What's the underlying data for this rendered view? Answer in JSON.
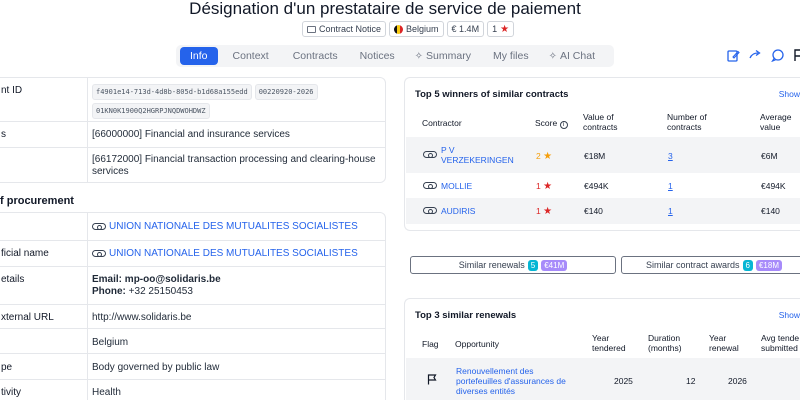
{
  "page": {
    "title": "Désignation d'un prestataire de service de paiement",
    "badges": {
      "notice": "Contract Notice",
      "country": "Belgium",
      "value": "€ 1.4M",
      "score": "1"
    }
  },
  "tabs": [
    {
      "label": "Info"
    },
    {
      "label": "Context"
    },
    {
      "label": "Contracts"
    },
    {
      "label": "Notices"
    },
    {
      "label": "Summary"
    },
    {
      "label": "My files"
    },
    {
      "label": "AI Chat"
    }
  ],
  "details": {
    "notice_id_label": "nt ID",
    "notice_id_values": [
      "f4901e14-713d-4d8b-805d-b1d68a155edd",
      "00220920-2026",
      "01KN0K1900Q2HGRPJNQDWOHDWZ"
    ],
    "cpv_label": "s",
    "cpv_main": "[66000000] Financial and insurance services",
    "cpv_secondary": "[66172000] Financial transaction processing and clearing-house services",
    "procurement_heading": "f procurement",
    "buyer_label": "",
    "buyer": "UNION NATIONALE DES MUTUALITES SOCIALISTES",
    "official_label": "ficial name",
    "official": "UNION NATIONALE DES MUTUALITES SOCIALISTES",
    "contact_label": "etails",
    "email_label": "Email:",
    "email": "mp-oo@solidaris.be",
    "phone_label": "Phone:",
    "phone": "+32 25150453",
    "url_label": "xternal URL",
    "url": "http://www.solidaris.be",
    "country_label": "",
    "country": "Belgium",
    "type_label": "pe",
    "type": "Body governed by public law",
    "activity_label": "tivity",
    "activity": "Health"
  },
  "winners": {
    "title": "Top 5 winners of similar contracts",
    "show": "Show",
    "headers": {
      "contractor": "Contractor",
      "score": "Score",
      "value": "Value of contracts",
      "number": "Number of contracts",
      "average": "Average value"
    },
    "rows": [
      {
        "name": "P V VERZEKERINGEN",
        "score": "2",
        "value": "€18M",
        "number": "3",
        "average": "€6M"
      },
      {
        "name": "MOLLIE",
        "score": "1",
        "value": "€494K",
        "number": "1",
        "average": "€494K"
      },
      {
        "name": "AUDIRIS",
        "score": "1",
        "value": "€140",
        "number": "1",
        "average": "€140"
      }
    ]
  },
  "buttons": {
    "renewals_label": "Similar renewals",
    "renewals_count": "5",
    "renewals_value": "€41M",
    "awards_label": "Similar contract awards",
    "awards_count": "6",
    "awards_value": "€18M"
  },
  "renewals": {
    "title": "Top 3 similar renewals",
    "show": "Show",
    "headers": {
      "flag": "Flag",
      "opportunity": "Opportunity",
      "year_tendered": "Year tendered",
      "duration": "Duration (months)",
      "year_renewal": "Year renewal",
      "avg_tenders": "Avg tende submitted"
    },
    "rows": [
      {
        "opportunity": "Renouvellement des portefeuilles d'assurances de diverses entités",
        "year_tendered": "2025",
        "duration": "12",
        "year_renewal": "2026"
      }
    ]
  },
  "colors": {
    "accent": "#2563eb",
    "score_red": "#dc2626",
    "score_orange": "#f59e0b",
    "pill_teal": "#06b6d4",
    "pill_purple": "#a78bfa"
  }
}
